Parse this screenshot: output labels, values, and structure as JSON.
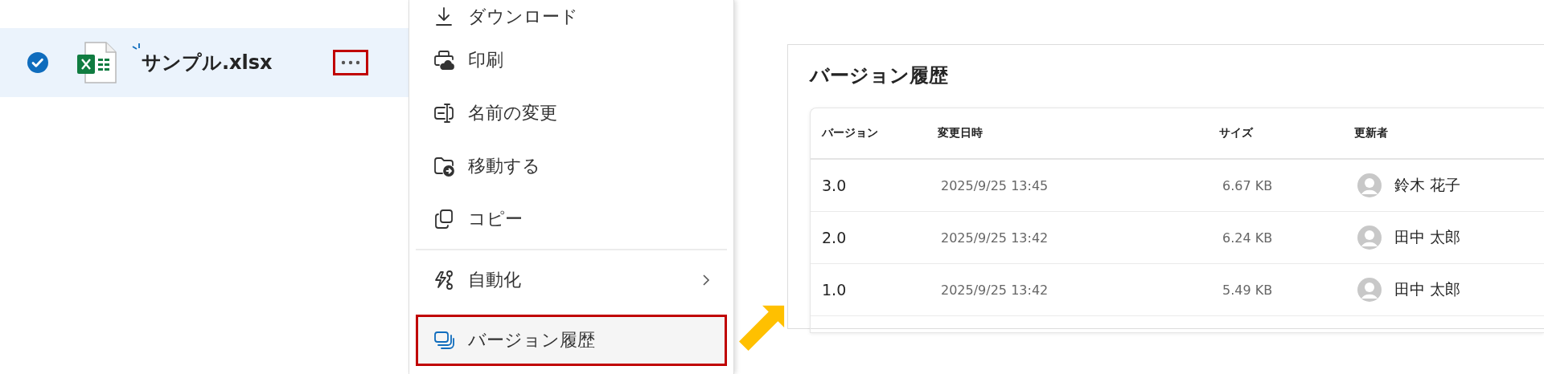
{
  "file_row": {
    "selected": true,
    "name": "サンプル.xlsx",
    "more_highlighted": true
  },
  "menu": {
    "groups": [
      [
        {
          "kind": "download",
          "label": "ダウンロード",
          "selected": false
        },
        {
          "kind": "print",
          "label": "印刷",
          "selected": false
        },
        {
          "kind": "rename",
          "label": "名前の変更",
          "selected": false
        },
        {
          "kind": "move",
          "label": "移動する",
          "selected": false
        },
        {
          "kind": "copy",
          "label": "コピー",
          "selected": false
        }
      ],
      [
        {
          "kind": "automate",
          "label": "自動化",
          "selected": false,
          "submenu": true
        },
        {
          "kind": "versions",
          "label": "バージョン履歴",
          "selected": true
        }
      ]
    ]
  },
  "version_panel": {
    "title": "バージョン履歴",
    "columns": [
      "バージョン",
      "変更日時",
      "サイズ",
      "更新者"
    ],
    "rows": [
      {
        "version": "3.0",
        "modified": "2025/9/25 13:45",
        "size": "6.67 KB",
        "author": "鈴木 花子"
      },
      {
        "version": "2.0",
        "modified": "2025/9/25 13:42",
        "size": "6.24 KB",
        "author": "田中 太郎"
      },
      {
        "version": "1.0",
        "modified": "2025/9/25 13:42",
        "size": "5.49 KB",
        "author": "田中 太郎"
      }
    ]
  }
}
